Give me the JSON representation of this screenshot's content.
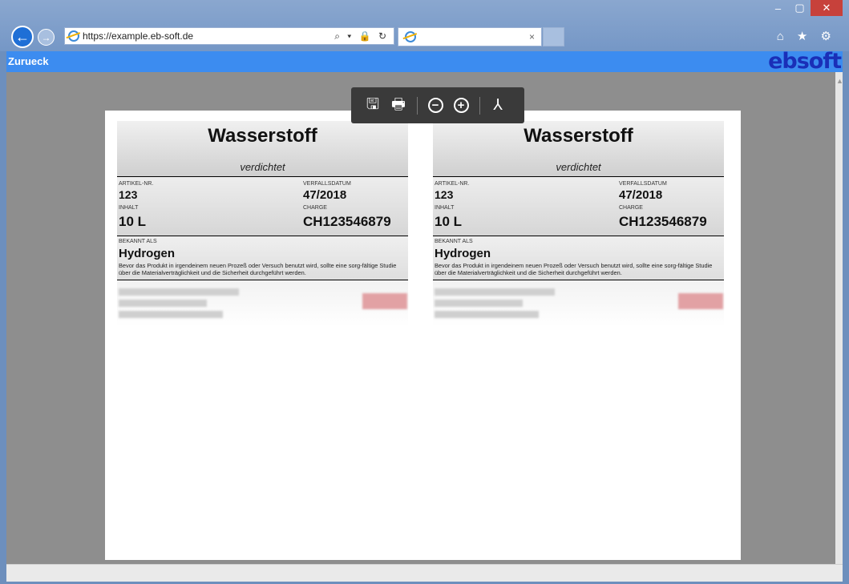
{
  "browser": {
    "url": "https://example.eb-soft.de",
    "address_tools": "⌕ ▾ 🔒 ↻",
    "tab_title": "",
    "tab_close": "×",
    "window_controls": [
      "–",
      "▢",
      "✕"
    ],
    "right_icons": "⌂ ★ ⚙"
  },
  "app": {
    "back_label": "Zurueck",
    "logo": "ebsoft"
  },
  "pdf_toolbar": {
    "save_glyph": "🖫",
    "print_glyph": "🖶",
    "zoom_out_glyph": "−",
    "zoom_in_glyph": "+",
    "acrobat_glyph": "⅄"
  },
  "labels": [
    {
      "title": "Wasserstoff",
      "subtitle": "verdichtet",
      "artikel_label": "ARTIKEL-NR.",
      "artikel": "123",
      "verfall_label": "VERFALLSDATUM",
      "verfall": "47/2018",
      "inhalt_label": "INHALT",
      "inhalt": "10 L",
      "charge_label": "CHARGE",
      "charge": "CH123546879",
      "bekannt_label": "BEKANNT ALS",
      "bekannt": "Hydrogen",
      "description": "Bevor das Produkt in irgendeinem neuen Prozeß oder Versuch benutzt wird, sollte eine sorg-fältige Studie über die Materialverträglichkeit und die Sicherheit durchgeführt werden."
    },
    {
      "title": "Wasserstoff",
      "subtitle": "verdichtet",
      "artikel_label": "ARTIKEL-NR.",
      "artikel": "123",
      "verfall_label": "VERFALLSDATUM",
      "verfall": "47/2018",
      "inhalt_label": "INHALT",
      "inhalt": "10 L",
      "charge_label": "CHARGE",
      "charge": "CH123546879",
      "bekannt_label": "BEKANNT ALS",
      "bekannt": "Hydrogen",
      "description": "Bevor das Produkt in irgendeinem neuen Prozeß oder Versuch benutzt wird, sollte eine sorg-fältige Studie über die Materialverträglichkeit und die Sicherheit durchgeführt werden."
    }
  ]
}
